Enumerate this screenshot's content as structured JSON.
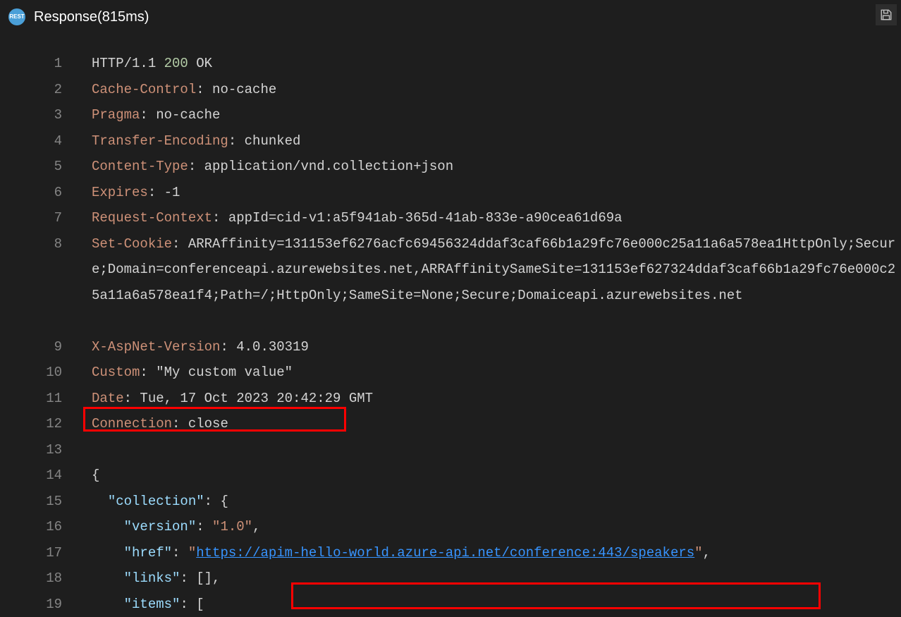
{
  "header": {
    "icon_label": "REST",
    "title": "Response(815ms)"
  },
  "toolbar": {
    "save_icon": "save-icon"
  },
  "code": {
    "line1": {
      "proto": "HTTP/1.1 ",
      "status": "200",
      "reason": " OK"
    },
    "line2": {
      "k": "Cache-Control",
      "v": ": no-cache"
    },
    "line3": {
      "k": "Pragma",
      "v": ": no-cache"
    },
    "line4": {
      "k": "Transfer-Encoding",
      "v": ": chunked"
    },
    "line5": {
      "k": "Content-Type",
      "v": ": application/vnd.collection+json"
    },
    "line6": {
      "k": "Expires",
      "v": ": -1"
    },
    "line7": {
      "k": "Request-Context",
      "v": ": appId=cid-v1:a5f941ab-365d-41ab-833e-a90cea61d69a"
    },
    "line8": {
      "k": "Set-Cookie",
      "v": ": ARRAffinity=131153ef6276acfc69456324ddaf3caf66b1a29fc76e000c25a11a6a578ea1HttpOnly;Secure;Domain=conferenceapi.azurewebsites.net,ARRAffinitySameSite=131153ef627324ddaf3caf66b1a29fc76e000c25a11a6a578ea1f4;Path=/;HttpOnly;SameSite=None;Secure;Domaiceapi.azurewebsites.net"
    },
    "line9": {
      "k": "X-AspNet-Version",
      "v": ": 4.0.30319"
    },
    "line10": {
      "k": "Custom",
      "v": ": \"My custom value\""
    },
    "line11": {
      "k": "Date",
      "v": ": Tue, 17 Oct 2023 20:42:29 GMT"
    },
    "line12": {
      "k": "Connection",
      "v": ": close"
    },
    "line14": "{",
    "line15": {
      "indent": "  ",
      "k": "\"collection\"",
      "after": ": {"
    },
    "line16": {
      "indent": "    ",
      "k": "\"version\"",
      "colon": ": ",
      "v": "\"1.0\"",
      "comma": ","
    },
    "line17": {
      "indent": "    ",
      "k": "\"href\"",
      "colon": ": ",
      "q1": "\"",
      "url": "https://apim-hello-world.azure-api.net/conference:443/speakers",
      "q2": "\"",
      "comma": ","
    },
    "line18": {
      "indent": "    ",
      "k": "\"links\"",
      "after": ": [],"
    },
    "line19": {
      "indent": "    ",
      "k": "\"items\"",
      "after": ": ["
    }
  },
  "linenums": [
    "1",
    "2",
    "3",
    "4",
    "5",
    "6",
    "7",
    "8",
    "",
    "",
    "",
    "9",
    "10",
    "11",
    "12",
    "13",
    "14",
    "15",
    "16",
    "17",
    "18",
    "19"
  ]
}
